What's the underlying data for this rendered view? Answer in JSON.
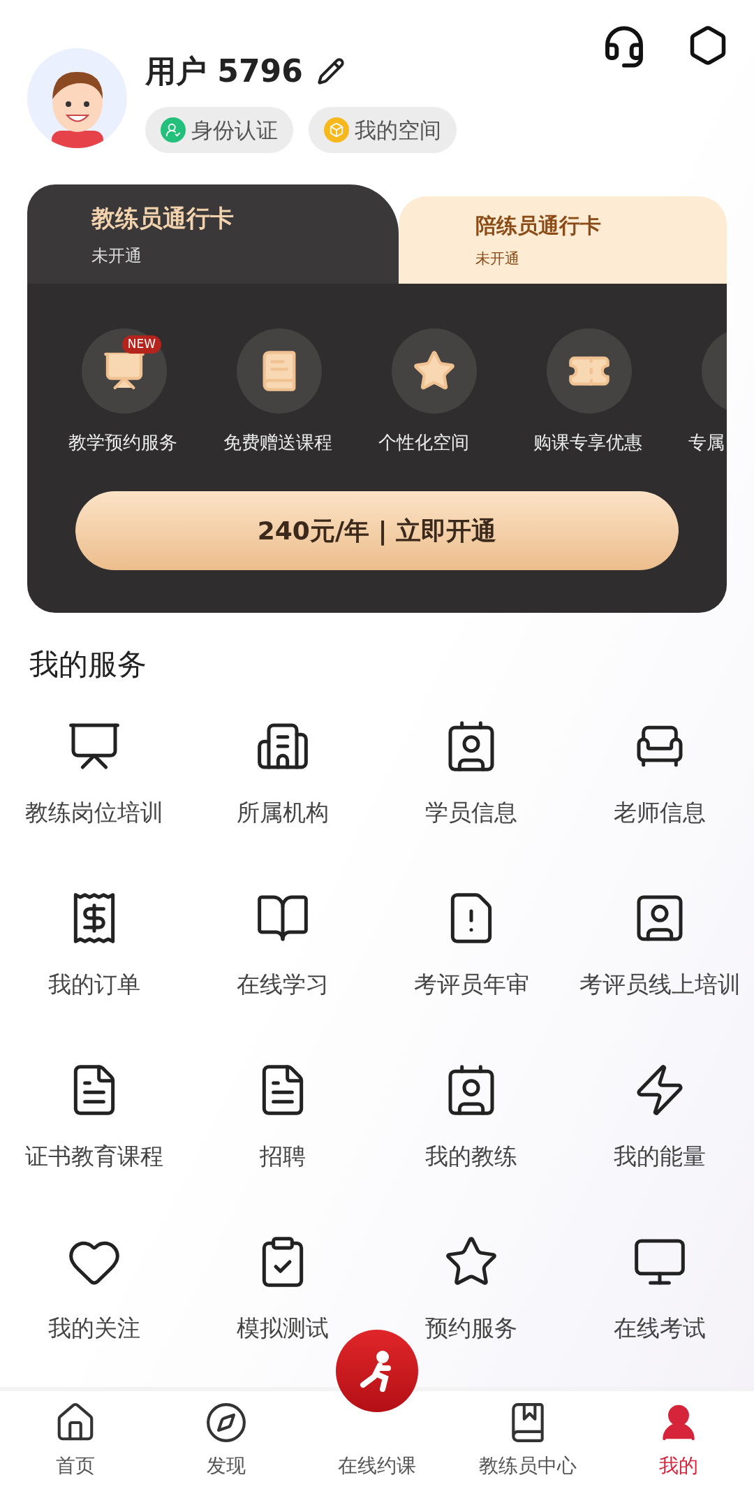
{
  "user": {
    "name": "用户 5796",
    "badges": [
      {
        "label": "身份认证",
        "kind": "verify"
      },
      {
        "label": "我的空间",
        "kind": "space"
      }
    ]
  },
  "pass_tabs": [
    {
      "title": "教练员通行卡",
      "status": "未开通",
      "selected": true
    },
    {
      "title": "陪练员通行卡",
      "status": "未开通",
      "selected": false
    }
  ],
  "benefits": [
    {
      "label": "教学预约服务",
      "badge": "NEW"
    },
    {
      "label": "免费赠送课程"
    },
    {
      "label": "个性化空间"
    },
    {
      "label": "购课专享优惠"
    },
    {
      "label": "专属"
    }
  ],
  "cta": "240元/年 | 立即开通",
  "services": {
    "title": "我的服务",
    "items": [
      {
        "label": "教练岗位培训"
      },
      {
        "label": "所属机构"
      },
      {
        "label": "学员信息"
      },
      {
        "label": "老师信息"
      },
      {
        "label": "我的订单"
      },
      {
        "label": "在线学习"
      },
      {
        "label": "考评员年审"
      },
      {
        "label": "考评员线上培训"
      },
      {
        "label": "证书教育课程"
      },
      {
        "label": "招聘"
      },
      {
        "label": "我的教练"
      },
      {
        "label": "我的能量"
      },
      {
        "label": "我的关注"
      },
      {
        "label": "模拟测试"
      },
      {
        "label": "预约服务"
      },
      {
        "label": "在线考试"
      }
    ]
  },
  "nav": [
    {
      "label": "首页",
      "kind": "tab",
      "selected": false
    },
    {
      "label": "发现",
      "kind": "tab",
      "selected": false
    },
    {
      "label": "在线约课",
      "kind": "center",
      "selected": false
    },
    {
      "label": "教练员中心",
      "kind": "tab",
      "selected": false
    },
    {
      "label": "我的",
      "kind": "tab",
      "selected": true
    }
  ]
}
